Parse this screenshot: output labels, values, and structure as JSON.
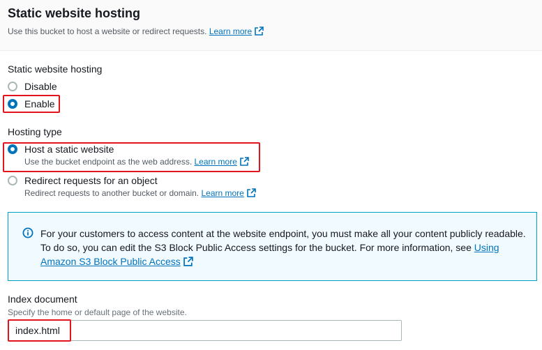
{
  "header": {
    "title": "Static website hosting",
    "subtitle": "Use this bucket to host a website or redirect requests.",
    "learn_more": "Learn more"
  },
  "hosting": {
    "label": "Static website hosting",
    "options": [
      {
        "label": "Disable",
        "selected": false
      },
      {
        "label": "Enable",
        "selected": true
      }
    ]
  },
  "hosting_type": {
    "label": "Hosting type",
    "options": [
      {
        "label": "Host a static website",
        "description": "Use the bucket endpoint as the web address.",
        "learn_more": "Learn more",
        "selected": true
      },
      {
        "label": "Redirect requests for an object",
        "description": "Redirect requests to another bucket or domain.",
        "learn_more": "Learn more",
        "selected": false
      }
    ]
  },
  "info": {
    "text": "For your customers to access content at the website endpoint, you must make all your content publicly readable. To do so, you can edit the S3 Block Public Access settings for the bucket. For more information, see",
    "link": "Using Amazon S3 Block Public Access"
  },
  "index_document": {
    "label": "Index document",
    "description": "Specify the home or default page of the website.",
    "value": "index.html"
  },
  "colors": {
    "accent": "#0073bb",
    "highlight": "#e3141b",
    "info_bg": "#f1faff",
    "info_border": "#00a1c9"
  },
  "icons": [
    "external-link-icon",
    "info-icon"
  ]
}
